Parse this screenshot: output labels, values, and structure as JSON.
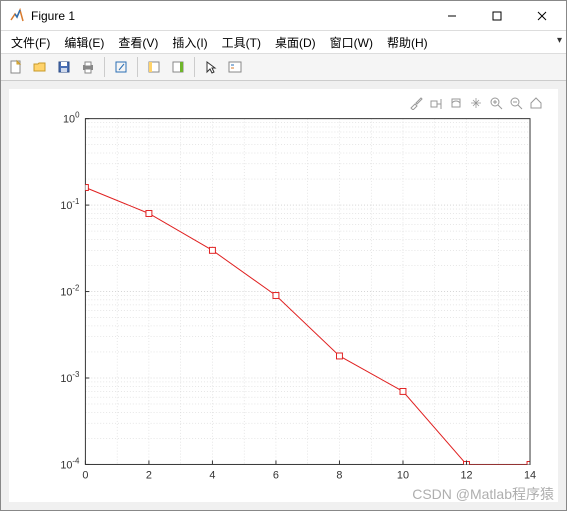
{
  "window": {
    "title": "Figure 1"
  },
  "menubar": {
    "file": "文件(F)",
    "edit": "编辑(E)",
    "view": "查看(V)",
    "insert": "插入(I)",
    "tools": "工具(T)",
    "desktop": "桌面(D)",
    "window_menu": "窗口(W)",
    "help": "帮助(H)"
  },
  "yticks": {
    "t0": "10",
    "t1": "10",
    "t2": "10",
    "t3": "10",
    "t4": "10",
    "e0": "0",
    "e1": "-1",
    "e2": "-2",
    "e3": "-3",
    "e4": "-4"
  },
  "xticks": {
    "x0": "0",
    "x2": "2",
    "x4": "4",
    "x6": "6",
    "x8": "8",
    "x10": "10",
    "x12": "12",
    "x14": "14"
  },
  "watermark": "CSDN @Matlab程序猿",
  "chart_data": {
    "type": "line",
    "x": [
      0,
      2,
      4,
      6,
      8,
      10,
      12,
      14
    ],
    "y": [
      0.16,
      0.08,
      0.03,
      0.009,
      0.0018,
      0.0007,
      0.0001,
      0.0001
    ],
    "yscale": "log",
    "ylim": [
      0.0001,
      1
    ],
    "xlim": [
      0,
      14
    ],
    "marker": "square",
    "color": "#e02020",
    "grid": true,
    "title": "",
    "xlabel": "",
    "ylabel": ""
  }
}
